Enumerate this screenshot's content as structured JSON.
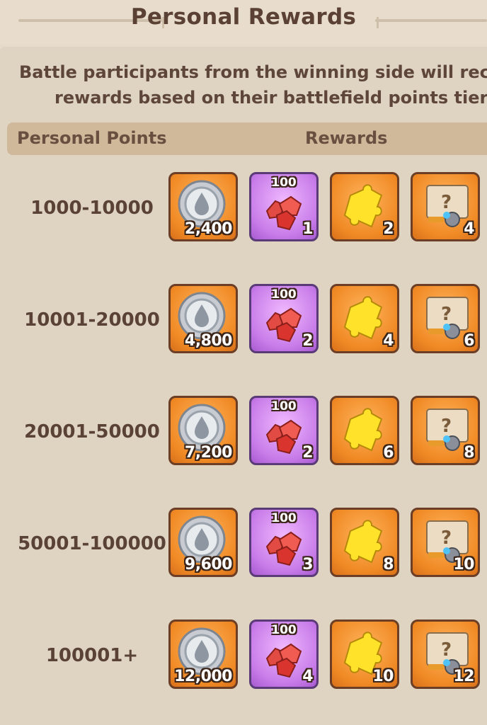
{
  "header": {
    "title": "Personal Rewards"
  },
  "description": {
    "line1": "Battle participants from the winning side will rece",
    "line2": "rewards based on their battlefield points tier."
  },
  "table": {
    "col_points": "Personal Points",
    "col_rewards": "Rewards",
    "rows": [
      {
        "tier": "1000-10000",
        "coins": "2,400",
        "gem_badge": "100",
        "gems": "1",
        "puzzle": "2",
        "chest": "4"
      },
      {
        "tier": "10001-20000",
        "coins": "4,800",
        "gem_badge": "100",
        "gems": "2",
        "puzzle": "4",
        "chest": "6"
      },
      {
        "tier": "20001-50000",
        "coins": "7,200",
        "gem_badge": "100",
        "gems": "2",
        "puzzle": "6",
        "chest": "8"
      },
      {
        "tier": "50001-100000",
        "coins": "9,600",
        "gem_badge": "100",
        "gems": "3",
        "puzzle": "8",
        "chest": "10"
      },
      {
        "tier": "100001+",
        "coins": "12,000",
        "gem_badge": "100",
        "gems": "4",
        "puzzle": "10",
        "chest": "12"
      }
    ]
  },
  "icons": {
    "coin": "silver-coin-icon",
    "gem": "red-gem-cluster-icon",
    "puzzle": "gold-puzzle-piece-icon",
    "chest": "mystery-gear-chest-icon"
  },
  "colors": {
    "background": "#e6dbca",
    "header_band": "#cfb99a",
    "orange_tile": "#f08a25",
    "purple_tile": "#c77be8",
    "text_dark": "#5a4134"
  }
}
